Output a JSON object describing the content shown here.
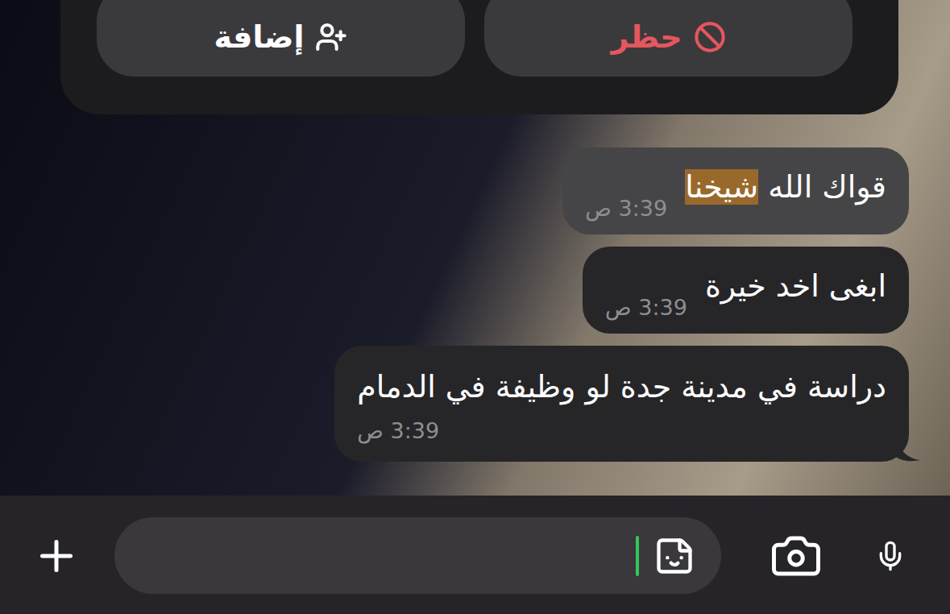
{
  "contact_actions": [
    {
      "label": "حظر",
      "kind": "block",
      "color": "#e5565f"
    },
    {
      "label": "إضافة",
      "kind": "add",
      "color": "#ffffff"
    }
  ],
  "messages": [
    {
      "parts": [
        {
          "text": "قواك الله ",
          "match": false
        },
        {
          "text": "شيخنا",
          "match": true
        }
      ],
      "time": "3:39 ص",
      "highlighted": true,
      "tail": false
    },
    {
      "parts": [
        {
          "text": "ابغى اخد خيرة",
          "match": false
        }
      ],
      "time": "3:39 ص",
      "highlighted": false,
      "tail": false
    },
    {
      "parts": [
        {
          "text": "دراسة في مدينة جدة لو وظيفة في الدمام",
          "match": false
        }
      ],
      "time": "3:39 ص",
      "highlighted": false,
      "tail": true
    }
  ],
  "composer": {
    "text": "",
    "focused": true
  }
}
